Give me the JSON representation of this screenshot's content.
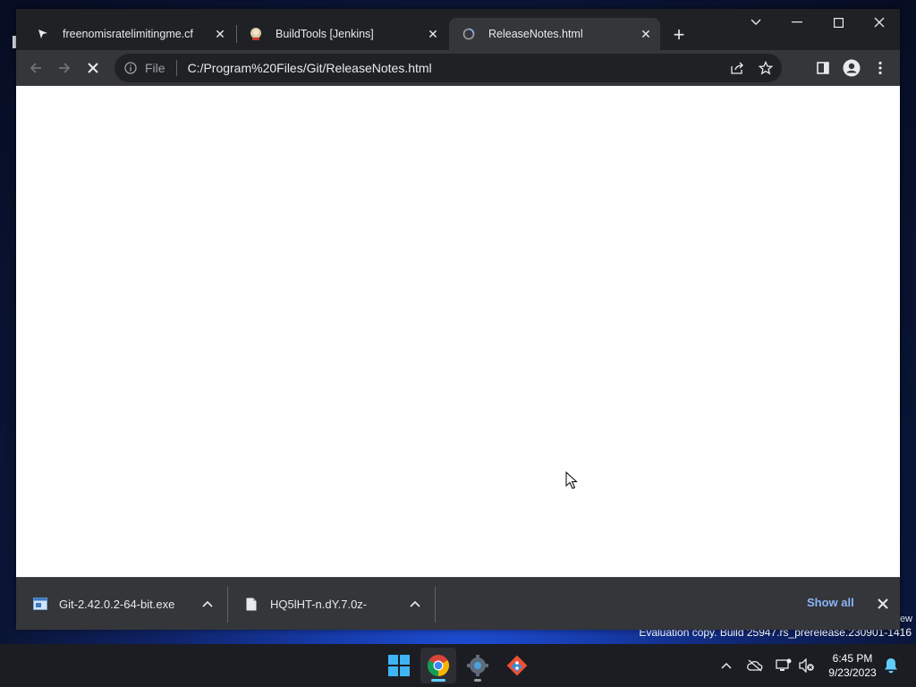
{
  "desktop": {
    "side_text": "ew",
    "watermark": "Evaluation copy. Build 25947.rs_prerelease.230901-1416"
  },
  "tabs": [
    {
      "title": "freenomisratelimitingme.cf",
      "icon": "cursor-favicon",
      "active": false
    },
    {
      "title": "BuildTools [Jenkins]",
      "icon": "jenkins-favicon",
      "active": false
    },
    {
      "title": "ReleaseNotes.html",
      "icon": "page-loading-favicon",
      "active": true
    }
  ],
  "omnibox": {
    "scheme_label": "File",
    "url": "C:/Program%20Files/Git/ReleaseNotes.html"
  },
  "downloads": {
    "items": [
      {
        "name": "Git-2.42.0.2-64-bit.exe",
        "icon": "installer-icon"
      },
      {
        "name": "HQ5lHT-n.dY.7.0z-",
        "icon": "file-icon"
      }
    ],
    "show_all_label": "Show all"
  },
  "taskbar": {
    "apps": [
      "start-button",
      "chrome-app",
      "settings-app",
      "git-app"
    ],
    "time": "6:45 PM",
    "date": "9/23/2023"
  },
  "colors": {
    "chrome_dark": "#202124",
    "chrome_toolbar": "#35363a",
    "link_blue": "#8ab4f8",
    "taskbar": "#1c1d22",
    "accent": "#60cdff"
  }
}
